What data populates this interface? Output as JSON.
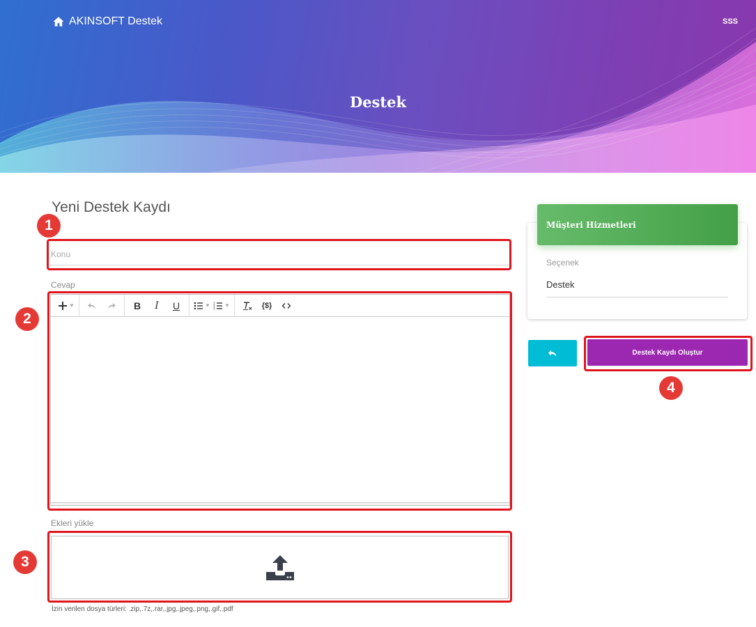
{
  "header": {
    "brand": "AKINSOFT Destek",
    "faq_link": "SSS",
    "hero_title": "Destek"
  },
  "form": {
    "title": "Yeni Destek Kaydı",
    "subject_placeholder": "Konu",
    "answer_label": "Cevap",
    "attachments_label": "Ekleri yükle",
    "allowed_types": "İzin verilen dosya türleri: .zip,.7z,.rar,.jpg,.jpeg,.png,.gif,.pdf"
  },
  "toolbar": {
    "bold": "B",
    "italic": "I",
    "underline": "U"
  },
  "panel": {
    "card_title": "Müşteri Hizmetleri",
    "option_label": "Seçenek",
    "option_value": "Destek",
    "create_button": "Destek Kaydı Oluştur"
  },
  "markers": [
    "1",
    "2",
    "3",
    "4"
  ],
  "colors": {
    "highlight": "#e0141b",
    "marker": "#e53935",
    "card_header": "#4caf50",
    "back_button": "#00bcd4",
    "create_button": "#9c27b0"
  }
}
